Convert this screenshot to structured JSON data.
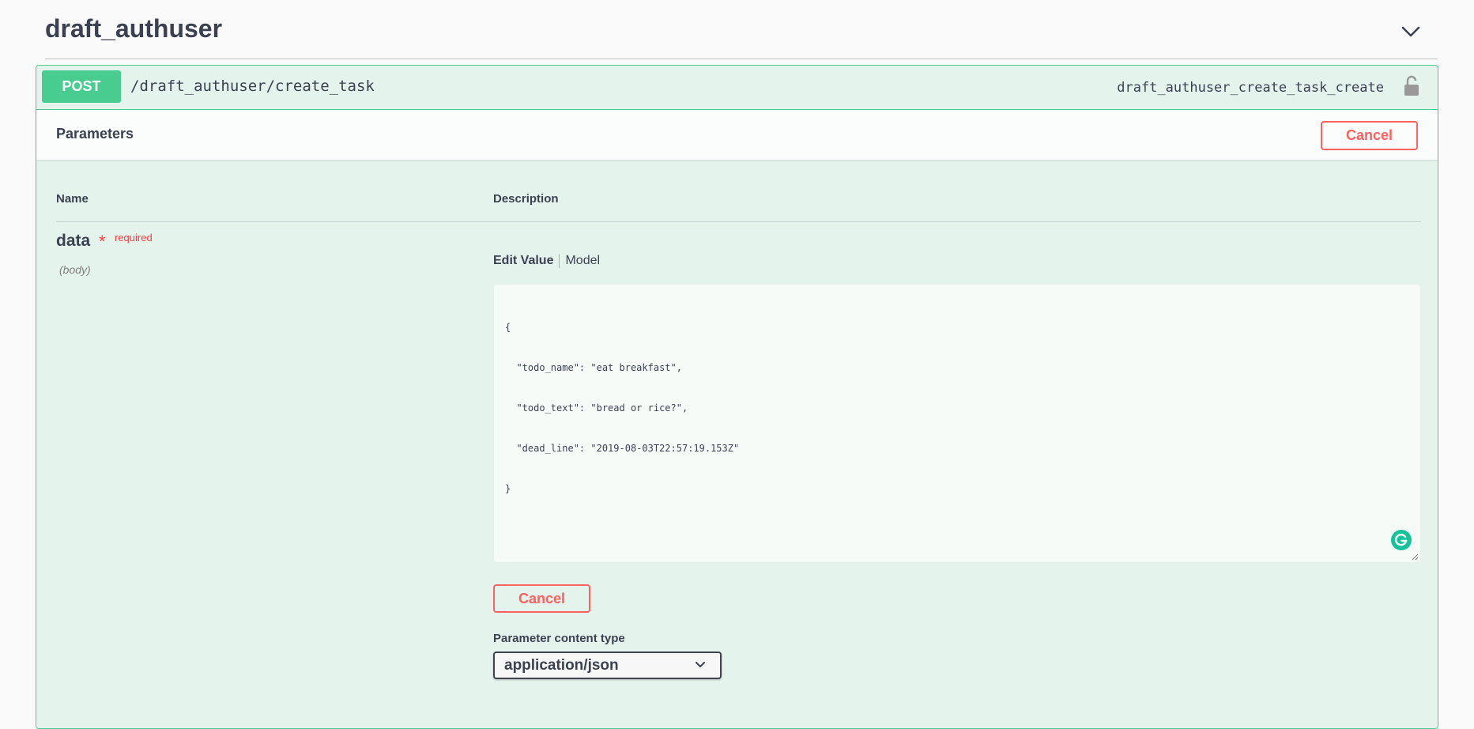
{
  "tag": {
    "title": "draft_authuser",
    "collapse_icon": "chevron-down-icon"
  },
  "operation": {
    "method": "POST",
    "path": "/draft_authuser/create_task",
    "operation_id": "draft_authuser_create_task_create",
    "lock_icon": "unlocked-padlock-icon",
    "colors": {
      "method_badge": "#49cc90",
      "block_background": "#e8f6f0",
      "cancel": "#ff6060",
      "required": "#f93e3e"
    }
  },
  "parameters": {
    "section_title": "Parameters",
    "cancel_label": "Cancel",
    "columns": {
      "name": "Name",
      "description": "Description"
    },
    "items": [
      {
        "name": "data",
        "required_mark": "*",
        "required_label": "required",
        "location": "(body)",
        "tabs": {
          "edit_value": "Edit Value",
          "model": "Model"
        },
        "body_lines": [
          "{",
          "  \"todo_name\": \"eat breakfast\",",
          "  \"todo_text\": \"bread or rice?\",",
          "  \"dead_line\": \"2019-08-03T22:57:19.153Z\"",
          "}"
        ],
        "editor_icon": "grammarly-icon"
      }
    ],
    "bottom_cancel_label": "Cancel",
    "content_type": {
      "label": "Parameter content type",
      "selected": "application/json"
    }
  }
}
